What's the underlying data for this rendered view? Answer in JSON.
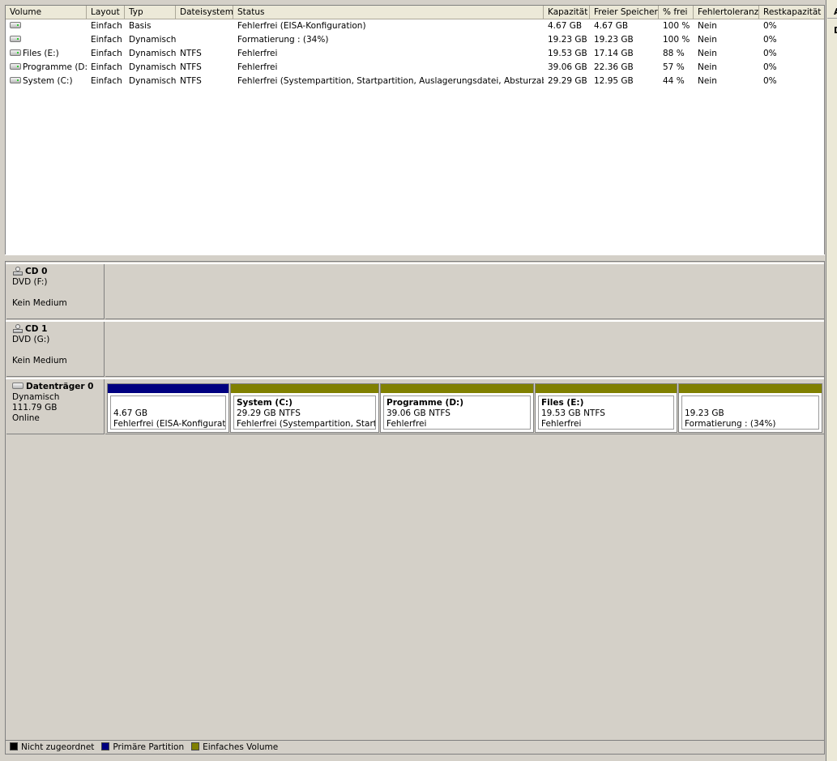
{
  "colors": {
    "unallocated": "#000000",
    "primary": "#000080",
    "simple": "#808000"
  },
  "right_pane": {
    "letter_a": "A",
    "letter_d": "D"
  },
  "columns": [
    "Volume",
    "Layout",
    "Typ",
    "Dateisystem",
    "Status",
    "Kapazität",
    "Freier Speicher",
    "% frei",
    "Fehlertoleranz",
    "Restkapazität"
  ],
  "volumes": [
    {
      "name": "",
      "layout": "Einfach",
      "type": "Basis",
      "fs": "",
      "status": "Fehlerfrei (EISA-Konfiguration)",
      "capacity": "4.67 GB",
      "free": "4.67 GB",
      "pct": "100 %",
      "fault": "Nein",
      "overhead": "0%"
    },
    {
      "name": "",
      "layout": "Einfach",
      "type": "Dynamisch",
      "fs": "",
      "status": "Formatierung : (34%)",
      "capacity": "19.23 GB",
      "free": "19.23 GB",
      "pct": "100 %",
      "fault": "Nein",
      "overhead": "0%"
    },
    {
      "name": "Files (E:)",
      "layout": "Einfach",
      "type": "Dynamisch",
      "fs": "NTFS",
      "status": "Fehlerfrei",
      "capacity": "19.53 GB",
      "free": "17.14 GB",
      "pct": "88 %",
      "fault": "Nein",
      "overhead": "0%"
    },
    {
      "name": "Programme (D:)",
      "layout": "Einfach",
      "type": "Dynamisch",
      "fs": "NTFS",
      "status": "Fehlerfrei",
      "capacity": "39.06 GB",
      "free": "22.36 GB",
      "pct": "57 %",
      "fault": "Nein",
      "overhead": "0%"
    },
    {
      "name": "System (C:)",
      "layout": "Einfach",
      "type": "Dynamisch",
      "fs": "NTFS",
      "status": "Fehlerfrei (Systempartition, Startpartition, Auslagerungsdatei, Absturzabbild)",
      "capacity": "29.29 GB",
      "free": "12.95 GB",
      "pct": "44 %",
      "fault": "Nein",
      "overhead": "0%"
    }
  ],
  "disks": [
    {
      "name": "CD 0",
      "line1": "DVD (F:)",
      "line2": "",
      "line3": "Kein Medium",
      "icon": "cd-drive-icon"
    },
    {
      "name": "CD 1",
      "line1": "DVD (G:)",
      "line2": "",
      "line3": "Kein Medium",
      "icon": "cd-drive-icon"
    },
    {
      "name": "Datenträger 0",
      "line1": "Dynamisch",
      "line2": "111.79 GB",
      "line3": "Online",
      "icon": "hard-disk-icon"
    }
  ],
  "partitions": [
    {
      "name": "",
      "size": "4.67 GB",
      "status": "Fehlerfrei (EISA-Konfiguration)",
      "kind": "primary"
    },
    {
      "name": "System  (C:)",
      "size": "29.29 GB NTFS",
      "status": "Fehlerfrei (Systempartition, Startpartition, Auslagerungsdatei, Absturzabbild)",
      "kind": "simple"
    },
    {
      "name": "Programme  (D:)",
      "size": "39.06 GB NTFS",
      "status": "Fehlerfrei",
      "kind": "simple"
    },
    {
      "name": "Files  (E:)",
      "size": "19.53 GB NTFS",
      "status": "Fehlerfrei",
      "kind": "simple"
    },
    {
      "name": "",
      "size": "19.23 GB",
      "status": "Formatierung : (34%)",
      "kind": "simple"
    }
  ],
  "legend": [
    {
      "label": "Nicht zugeordnet",
      "kind": "unallocated"
    },
    {
      "label": "Primäre Partition",
      "kind": "primary"
    },
    {
      "label": "Einfaches Volume",
      "kind": "simple"
    }
  ]
}
